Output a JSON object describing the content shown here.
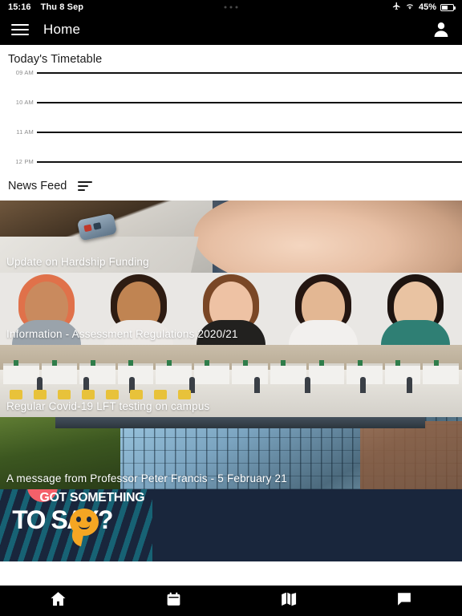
{
  "status_bar": {
    "time": "15:16",
    "date": "Thu 8 Sep",
    "battery_percent": "45%",
    "icons": [
      "airplane-mode-icon",
      "wifi-icon",
      "battery-icon"
    ]
  },
  "app_bar": {
    "title": "Home",
    "menu_icon": "hamburger-menu-icon",
    "profile_icon": "person-avatar-icon"
  },
  "timetable": {
    "title": "Today's Timetable",
    "hours": [
      "09 AM",
      "10 AM",
      "11 AM",
      "12 PM"
    ],
    "events": []
  },
  "news_feed": {
    "title": "News Feed",
    "sort_icon": "sort-filter-icon",
    "items": [
      {
        "title": "Update on Hardship Funding"
      },
      {
        "title": "Information - Assessment Regulations 2020/21"
      },
      {
        "title": "Regular Covid-19 LFT testing on campus"
      },
      {
        "title": "A message from Professor Peter Francis - 5 February 21"
      },
      {
        "title": "",
        "poster_line1": "GOT SOMETHING",
        "poster_line2": "TO SAY?"
      }
    ]
  },
  "bottom_nav": {
    "items": [
      {
        "name": "home",
        "icon": "home-icon"
      },
      {
        "name": "calendar",
        "icon": "calendar-icon"
      },
      {
        "name": "map",
        "icon": "map-icon"
      },
      {
        "name": "messages",
        "icon": "chat-bubble-icon"
      }
    ]
  },
  "colors": {
    "bar_background": "#000000",
    "page_background": "#ffffff",
    "poster_background": "#19263c",
    "accent_yellow": "#f5a623"
  }
}
